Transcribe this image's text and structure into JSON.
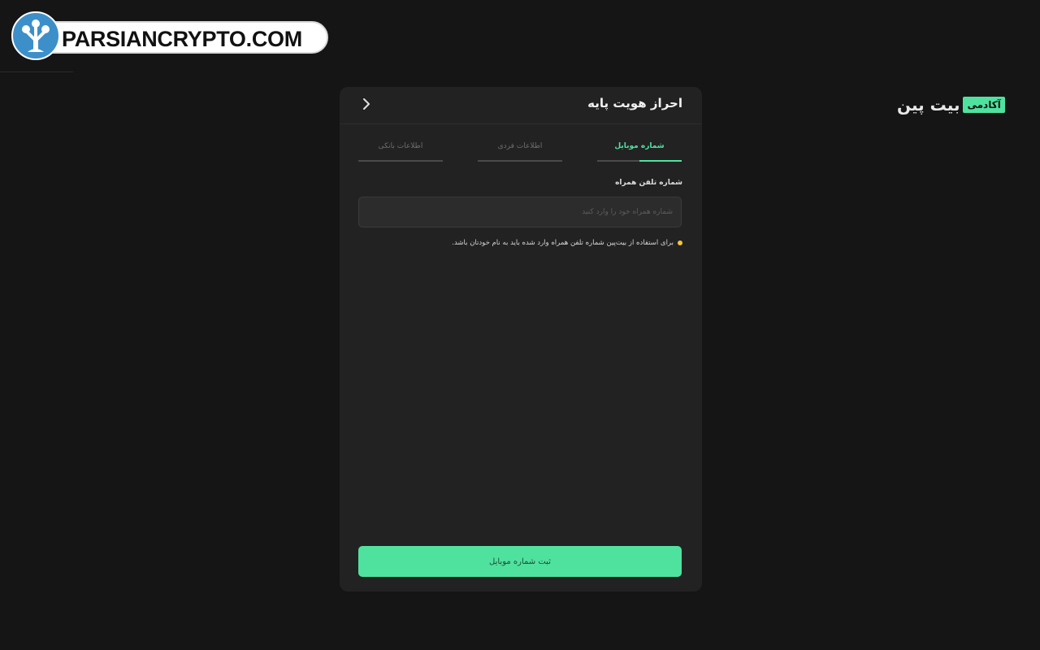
{
  "watermark": {
    "text": "PARSIANCRYPTO.COM",
    "logo_icon": "tree-logo-icon"
  },
  "brand": {
    "name": "بیت پین",
    "badge": "آکادمی",
    "accent": "#4fe29f"
  },
  "card": {
    "title": "احراز هویت پایه",
    "back_icon": "chevron-right-icon"
  },
  "steps": [
    {
      "label": "شماره موبایل",
      "active": true,
      "progress": 0.5
    },
    {
      "label": "اطلاعات فردی",
      "active": false
    },
    {
      "label": "اطلاعات بانکی",
      "active": false
    }
  ],
  "form": {
    "label": "شماره تلفن همراه",
    "placeholder": "شماره همراه خود را وارد کنید",
    "value": "",
    "note": "برای استفاده از بیت‌پین شماره تلفن همراه وارد شده باید به نام خودتان باشد.",
    "submit_label": "ثبت شماره موبایل"
  },
  "colors": {
    "background": "#151515",
    "card": "#222222",
    "accent": "#4fe29f",
    "note_dot": "#f2c53d"
  }
}
